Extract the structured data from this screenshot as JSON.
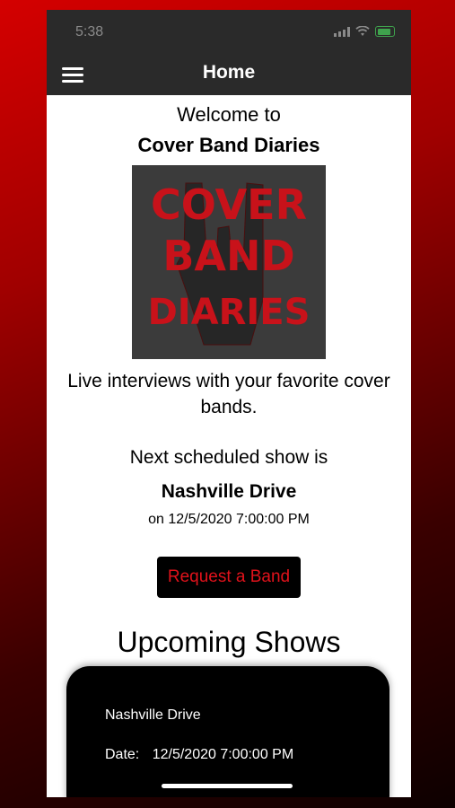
{
  "status": {
    "time": "5:38"
  },
  "nav": {
    "title": "Home"
  },
  "home": {
    "welcome": "Welcome to",
    "app_name": "Cover Band Diaries",
    "logo_text": [
      "COVER",
      "BAND",
      "DIARIES"
    ],
    "tagline": "Live interviews with your favorite cover bands.",
    "next_show_label": "Next scheduled show is",
    "next_band": "Nashville Drive",
    "next_date": "on 12/5/2020 7:00:00 PM",
    "request_button": "Request a Band",
    "upcoming_title": "Upcoming Shows"
  },
  "upcoming_shows": [
    {
      "band": "Nashville Drive",
      "date_label": "Date:",
      "date": "12/5/2020 7:00:00 PM"
    }
  ],
  "colors": {
    "accent": "#e0121b",
    "bar": "#2a2a2a",
    "logo_bg": "#3b3b3b"
  },
  "icons": [
    "hamburger-menu-icon",
    "signal-icon",
    "wifi-icon",
    "battery-icon",
    "rock-hand-icon"
  ]
}
